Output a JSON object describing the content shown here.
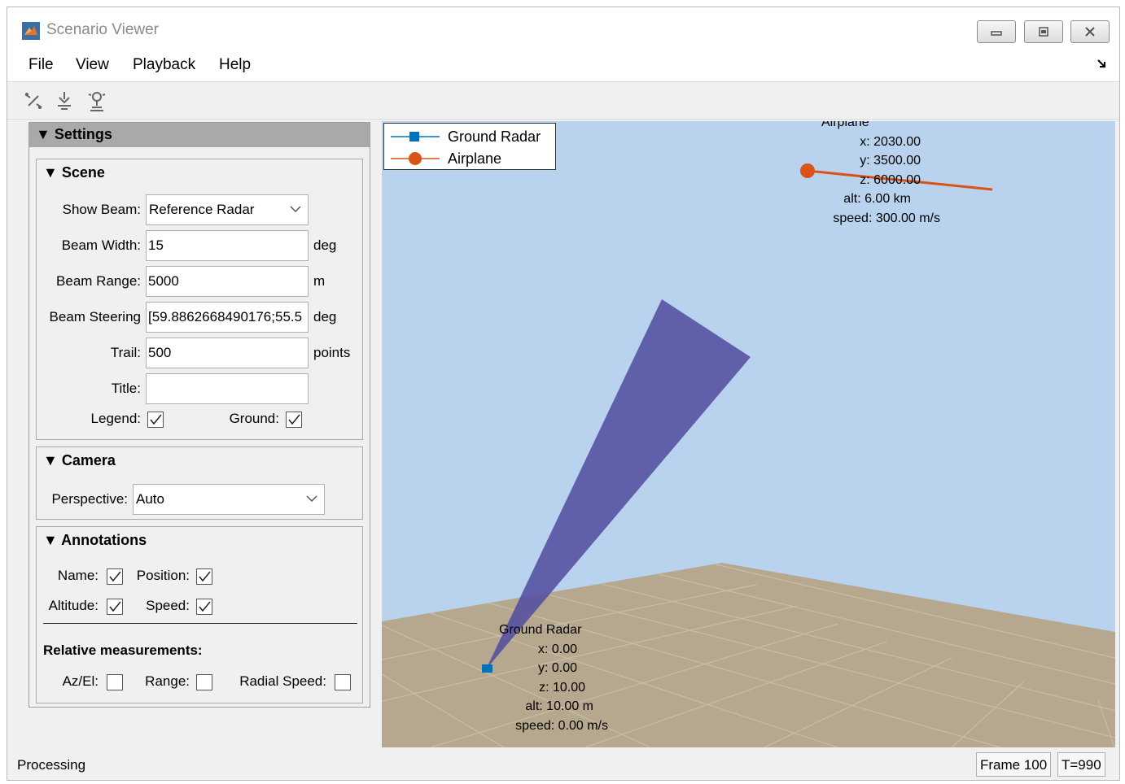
{
  "window": {
    "title": "Scenario Viewer",
    "controls": [
      "minimize-icon",
      "restore-icon",
      "close-icon"
    ]
  },
  "menu": {
    "items": [
      "File",
      "View",
      "Playback",
      "Help"
    ]
  },
  "toolbar": {
    "tools": [
      "pan-tool-icon",
      "rotate-tool-icon",
      "light-tool-icon"
    ]
  },
  "settings": {
    "header": "▼ Settings",
    "scene": {
      "title": "▼ Scene",
      "show_beam_label": "Show Beam:",
      "show_beam_value": "Reference Radar",
      "beam_width_label": "Beam Width:",
      "beam_width_value": "15",
      "beam_width_unit": "deg",
      "beam_range_label": "Beam Range:",
      "beam_range_value": "5000",
      "beam_range_unit": "m",
      "beam_steering_label": "Beam Steering",
      "beam_steering_value": "[59.8862668490176;55.5",
      "beam_steering_unit": "deg",
      "trail_label": "Trail:",
      "trail_value": "500",
      "trail_unit": "points",
      "title_label": "Title:",
      "title_value": "",
      "legend_label": "Legend:",
      "legend_checked": true,
      "ground_label": "Ground:",
      "ground_checked": true
    },
    "camera": {
      "title": "▼ Camera",
      "perspective_label": "Perspective:",
      "perspective_value": "Auto"
    },
    "annotations": {
      "title": "▼ Annotations",
      "name_label": "Name:",
      "name_checked": true,
      "position_label": "Position:",
      "position_checked": true,
      "altitude_label": "Altitude:",
      "altitude_checked": true,
      "speed_label": "Speed:",
      "speed_checked": true,
      "relative_title": "Relative measurements:",
      "azel_label": "Az/El:",
      "azel_checked": false,
      "range_label": "Range:",
      "range_checked": false,
      "radial_speed_label": "Radial Speed:",
      "radial_speed_checked": false
    }
  },
  "plot": {
    "legend": [
      {
        "name": "Ground Radar",
        "color": "#0072bd",
        "marker": "square"
      },
      {
        "name": "Airplane",
        "color": "#d95319",
        "marker": "circle"
      }
    ],
    "airplane": {
      "name": "Airplane",
      "x": "x: 2030.00",
      "y": "y: 3500.00",
      "z": "z: 6000.00",
      "alt": "alt: 6.00 km",
      "speed": "speed: 300.00 m/s"
    },
    "radar": {
      "name": "Ground Radar",
      "x": "x: 0.00",
      "y": "y: 0.00",
      "z": "z: 10.00",
      "alt": "alt: 10.00 m",
      "speed": "speed: 0.00 m/s"
    },
    "colors": {
      "sky": "#b9d3ee",
      "ground": "#b6a88e",
      "beam": "#534ea0",
      "trail": "#d95319"
    }
  },
  "status": {
    "text": "Processing",
    "frame": "Frame 100",
    "time": "T=990"
  }
}
